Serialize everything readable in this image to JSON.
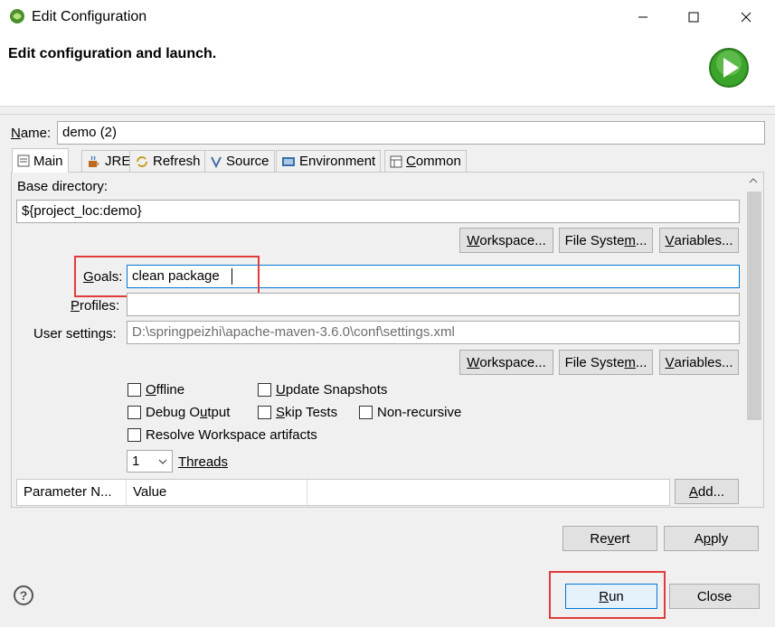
{
  "window": {
    "title": "Edit Configuration"
  },
  "banner": {
    "title": "Edit configuration and launch."
  },
  "name_field": {
    "label": "Name:",
    "value": "demo (2)"
  },
  "tabs": [
    {
      "label": "Main",
      "icon": "main-tab-icon",
      "active": true
    },
    {
      "label": "JRE",
      "icon": "jre-icon",
      "active": false
    },
    {
      "label": "Refresh",
      "icon": "refresh-icon",
      "active": false
    },
    {
      "label": "Source",
      "icon": "source-icon",
      "active": false
    },
    {
      "label": "Environment",
      "icon": "environment-icon",
      "active": false
    },
    {
      "label": "Common",
      "icon": "common-icon",
      "active": false
    }
  ],
  "main": {
    "base_directory_label": "Base directory:",
    "base_directory_value": "${project_loc:demo}",
    "workspace_button": "Workspace...",
    "filesystem_button": "File System...",
    "variables_button": "Variables...",
    "goals_label": "Goals:",
    "goals_value": "clean package",
    "profiles_label": "Profiles:",
    "profiles_value": "",
    "user_settings_label": "User settings:",
    "user_settings_value": "D:\\springpeizhi\\apache-maven-3.6.0\\conf\\settings.xml",
    "checkboxes": {
      "offline": {
        "label": "Offline",
        "checked": false
      },
      "update_snapshots": {
        "label": "Update Snapshots",
        "checked": false
      },
      "debug_output": {
        "label": "Debug Output",
        "checked": false
      },
      "skip_tests": {
        "label": "Skip Tests",
        "checked": false
      },
      "non_recursive": {
        "label": "Non-recursive",
        "checked": false
      },
      "resolve_workspace": {
        "label": "Resolve Workspace artifacts",
        "checked": false
      }
    },
    "threads_value": "1",
    "threads_label": "Threads",
    "table_headers": [
      "Parameter N...",
      "Value"
    ],
    "add_button": "Add..."
  },
  "footer": {
    "revert_button": "Revert",
    "apply_button": "Apply",
    "run_button": "Run",
    "close_button": "Close"
  },
  "colors": {
    "highlight": "#e23a3a",
    "run_logo": "#3aa52a",
    "focus_border": "#0078d7"
  }
}
